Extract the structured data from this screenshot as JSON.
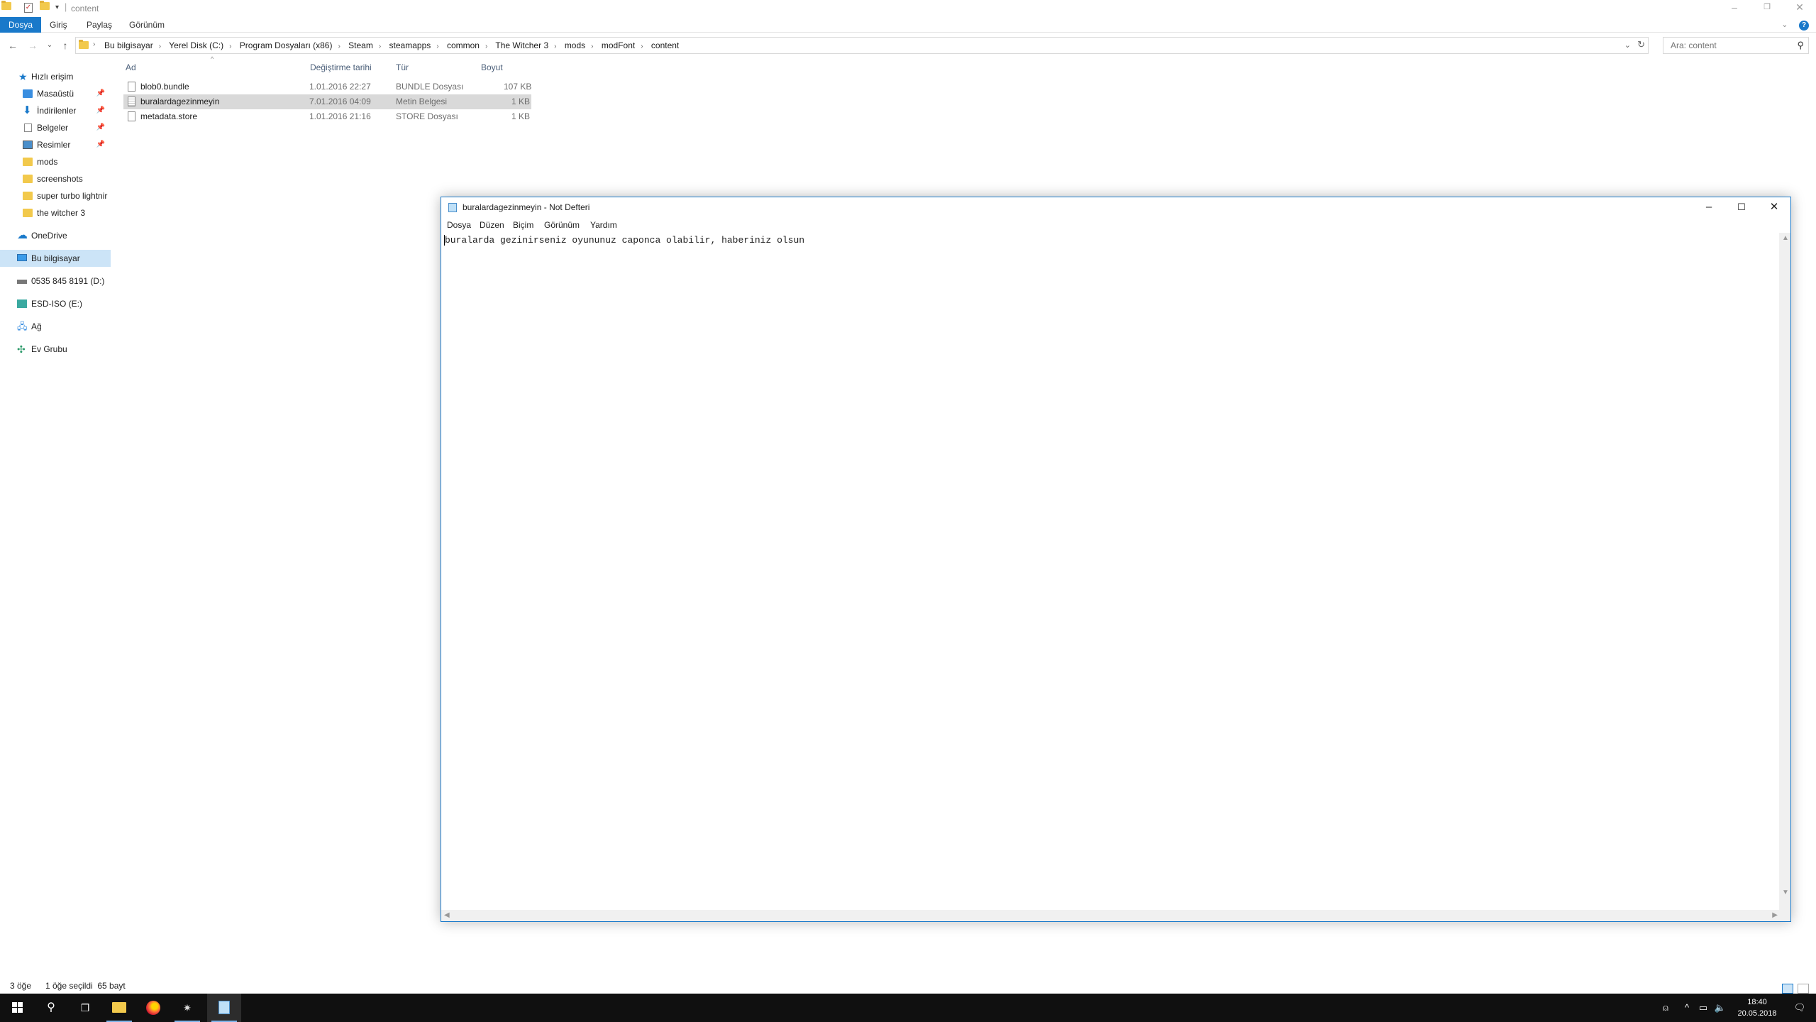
{
  "explorer": {
    "title": "content",
    "ribbon_tabs": [
      "Dosya",
      "Giriş",
      "Paylaş",
      "Görünüm"
    ],
    "breadcrumbs": [
      "Bu bilgisayar",
      "Yerel Disk (C:)",
      "Program Dosyaları (x86)",
      "Steam",
      "steamapps",
      "common",
      "The Witcher 3",
      "mods",
      "modFont",
      "content"
    ],
    "search_placeholder": "Ara: content",
    "nav": {
      "quick_access": "Hızlı erişim",
      "items": [
        "Masaüstü",
        "İndirilenler",
        "Belgeler",
        "Resimler",
        "mods",
        "screenshots",
        "super turbo lightnir",
        "the witcher 3"
      ],
      "onedrive": "OneDrive",
      "this_pc": "Bu bilgisayar",
      "drive_d": "0535 845 8191 (D:)",
      "drive_e": "ESD-ISO (E:)",
      "network": "Ağ",
      "homegroup": "Ev Grubu"
    },
    "columns": {
      "name": "Ad",
      "date": "Değiştirme tarihi",
      "type": "Tür",
      "size": "Boyut"
    },
    "files": [
      {
        "name": "blob0.bundle",
        "date": "1.01.2016 22:27",
        "type": "BUNDLE Dosyası",
        "size": "107 KB"
      },
      {
        "name": "buralardagezinmeyin",
        "date": "7.01.2016 04:09",
        "type": "Metin Belgesi",
        "size": "1 KB"
      },
      {
        "name": "metadata.store",
        "date": "1.01.2016 21:16",
        "type": "STORE Dosyası",
        "size": "1 KB"
      }
    ],
    "status": {
      "count": "3 öğe",
      "selection": "1 öğe seçildi  65 bayt"
    }
  },
  "notepad": {
    "title": "buralardagezinmeyin - Not Defteri",
    "menu": [
      "Dosya",
      "Düzen",
      "Biçim",
      "Görünüm",
      "Yardım"
    ],
    "content": "buralarda gezinirseniz oyununuz caponca olabilir, haberiniz olsun"
  },
  "taskbar": {
    "time": "18:40",
    "date": "20.05.2018"
  },
  "colors": {
    "accent": "#1979ca",
    "selection": "#cce4f7",
    "taskbar": "#101010"
  }
}
